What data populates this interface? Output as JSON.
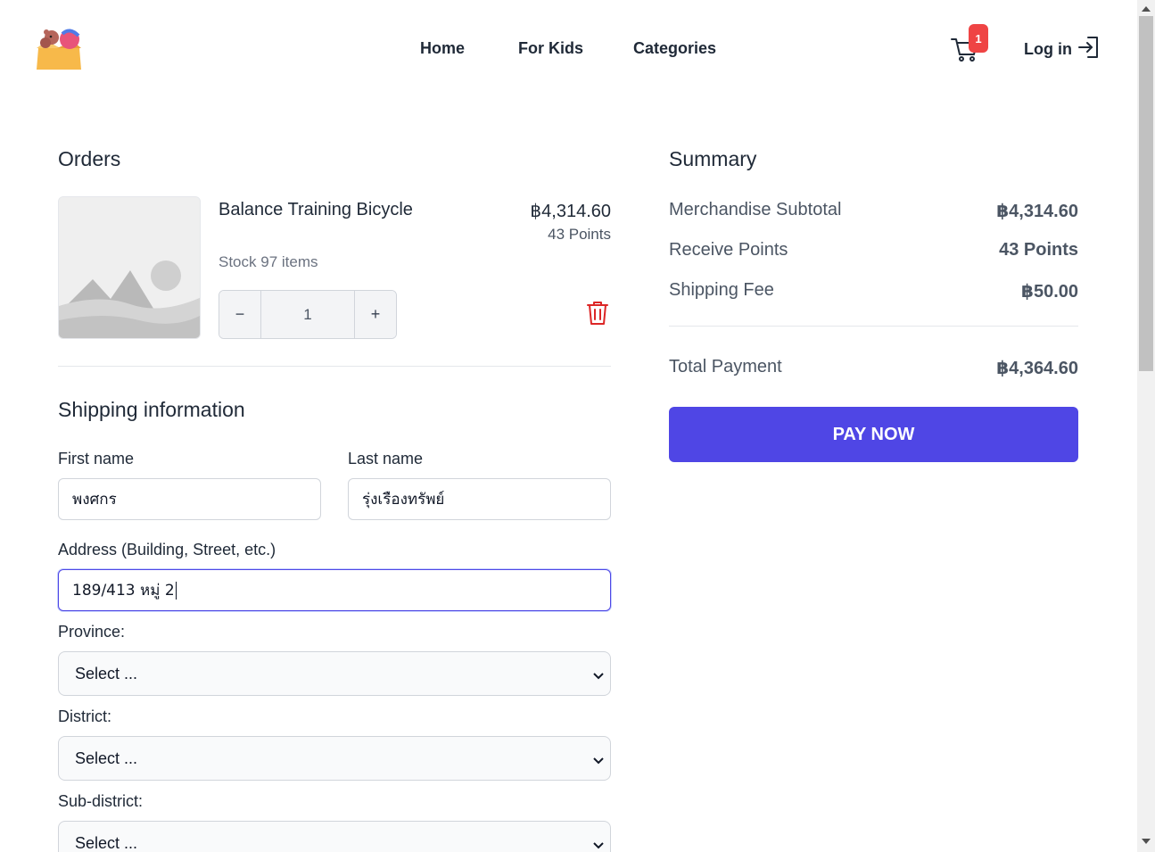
{
  "nav": {
    "links": [
      "Home",
      "For Kids",
      "Categories"
    ],
    "cart_count": "1",
    "login_label": "Log in"
  },
  "orders": {
    "title": "Orders",
    "item": {
      "name": "Balance Training Bicycle",
      "price": "฿4,314.60",
      "points": "43 Points",
      "stock": "Stock 97 items",
      "quantity": "1",
      "minus": "−",
      "plus": "+"
    }
  },
  "shipping": {
    "title": "Shipping information",
    "first_name_label": "First name",
    "first_name_value": "พงศกร",
    "last_name_label": "Last name",
    "last_name_value": "รุ่งเรืองทรัพย์",
    "address_label": "Address (Building, Street, etc.)",
    "address_value": "189/413 หมู่ 2",
    "province_label": "Province:",
    "province_value": "Select ...",
    "district_label": "District:",
    "district_value": "Select ...",
    "subdistrict_label": "Sub-district:",
    "subdistrict_value": "Select ..."
  },
  "summary": {
    "title": "Summary",
    "merch_label": "Merchandise Subtotal",
    "merch_value": "฿4,314.60",
    "points_label": "Receive Points",
    "points_value": "43 Points",
    "shipping_label": "Shipping Fee",
    "shipping_value": "฿50.00",
    "total_label": "Total Payment",
    "total_value": "฿4,364.60",
    "pay_label": "PAY NOW"
  },
  "colors": {
    "accent": "#4f46e5",
    "badge": "#ef4444",
    "trash": "#dc2626"
  }
}
